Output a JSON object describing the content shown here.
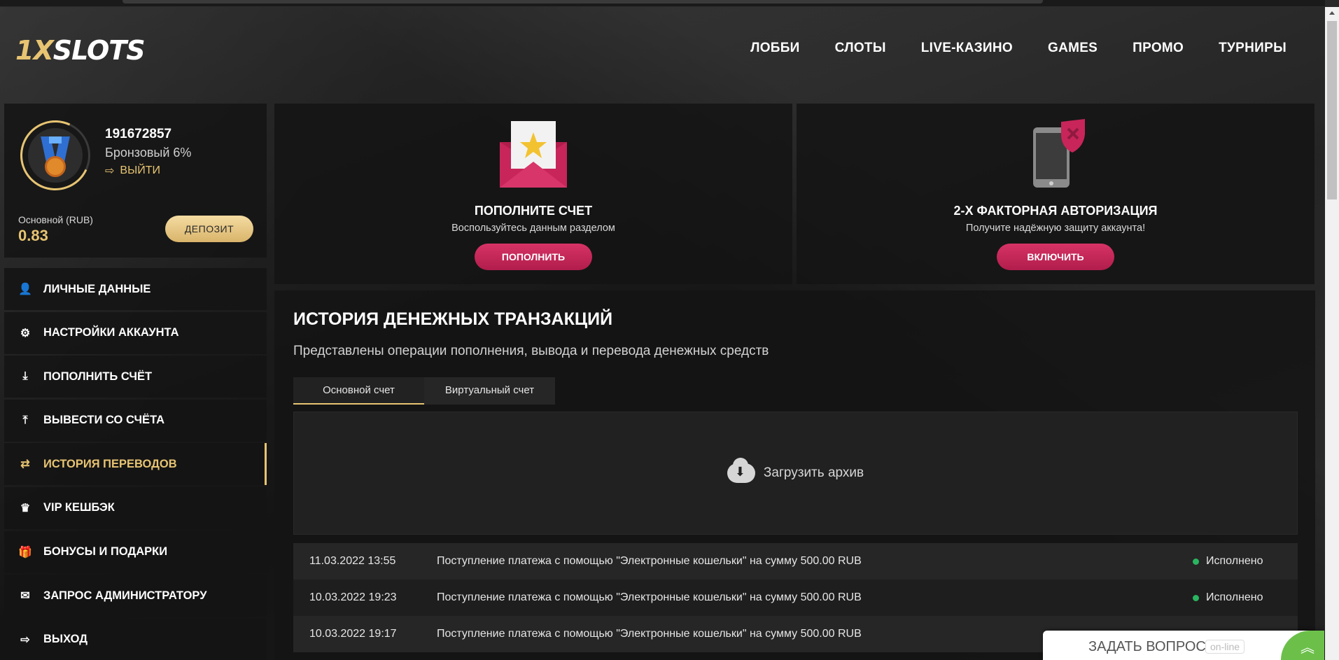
{
  "header": {
    "logo_prefix": "1X",
    "logo_suffix": "SLOTS",
    "nav": [
      "ЛОББИ",
      "СЛОТЫ",
      "LIVE-КАЗИНО",
      "GAMES",
      "ПРОМО",
      "ТУРНИРЫ"
    ]
  },
  "profile": {
    "user_id": "191672857",
    "level": "Бронзовый 6%",
    "logout": "ВЫЙТИ",
    "balance_label": "Основной (RUB)",
    "balance_value": "0.83",
    "deposit_button": "ДЕПОЗИТ"
  },
  "menu": [
    {
      "label": "ЛИЧНЫЕ ДАННЫЕ",
      "icon": "user-plus-icon"
    },
    {
      "label": "НАСТРОЙКИ АККАУНТА",
      "icon": "gears-icon"
    },
    {
      "label": "ПОПОЛНИТЬ СЧЁТ",
      "icon": "download-icon"
    },
    {
      "label": "ВЫВЕСТИ СО СЧЁТА",
      "icon": "upload-icon"
    },
    {
      "label": "ИСТОРИЯ ПЕРЕВОДОВ",
      "icon": "exchange-icon",
      "active": true
    },
    {
      "label": "VIP КЕШБЭК",
      "icon": "crown-icon"
    },
    {
      "label": "БОНУСЫ И ПОДАРКИ",
      "icon": "gift-icon"
    },
    {
      "label": "ЗАПРОС АДМИНИСТРАТОРУ",
      "icon": "envelope-icon"
    },
    {
      "label": "ВЫХОД",
      "icon": "sign-out-icon"
    }
  ],
  "cards": {
    "deposit": {
      "title": "ПОПОЛНИТЕ СЧЕТ",
      "subtitle": "Воспользуйтесь данным разделом",
      "button": "ПОПОЛНИТЬ"
    },
    "twofa": {
      "title": "2-Х ФАКТОРНАЯ АВТОРИЗАЦИЯ",
      "subtitle": "Получите надёжную защиту аккаунта!",
      "button": "ВКЛЮЧИТЬ"
    }
  },
  "history": {
    "title": "ИСТОРИЯ ДЕНЕЖНЫХ ТРАНЗАКЦИЙ",
    "subtitle": "Представлены операции пополнения, вывода и перевода денежных средств",
    "tabs": [
      "Основной счет",
      "Виртуальный счет"
    ],
    "archive": "Загрузить архив",
    "rows": [
      {
        "date": "11.03.2022 13:55",
        "desc": "Поступление платежа с помощью \"Электронные кошельки\" на сумму 500.00 RUB",
        "status": "Исполнено"
      },
      {
        "date": "10.03.2022 19:23",
        "desc": "Поступление платежа с помощью \"Электронные кошельки\" на сумму 500.00 RUB",
        "status": "Исполнено"
      },
      {
        "date": "10.03.2022 19:17",
        "desc": "Поступление платежа с помощью \"Электронные кошельки\" на сумму 500.00 RUB",
        "status": ""
      }
    ]
  },
  "chat": {
    "label": "ЗАДАТЬ ВОПРОС",
    "status": "on-line"
  },
  "colors": {
    "accent_gold": "#e7c472",
    "accent_pink": "#c8255a",
    "status_green": "#2ab561"
  }
}
